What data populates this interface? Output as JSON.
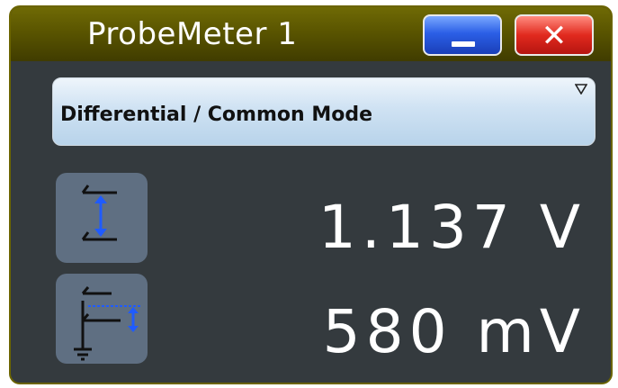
{
  "window": {
    "title": "ProbeMeter 1",
    "minimize_icon": "minimize-icon",
    "close_icon": "close-icon",
    "close_glyph": "✕"
  },
  "mode_select": {
    "selected": "Differential / Common Mode",
    "caret_icon": "caret-down-icon"
  },
  "measurements": [
    {
      "icon": "differential-voltage-icon",
      "value": "1.137 V"
    },
    {
      "icon": "common-mode-voltage-icon",
      "value": "580 mV"
    }
  ],
  "colors": {
    "titlebar": "#5a5500",
    "background": "#343a3e",
    "minimize_button": "#2b5fe6",
    "close_button": "#e12a1e",
    "icon_button": "#5f6f82",
    "icon_accent": "#1f5bff"
  }
}
